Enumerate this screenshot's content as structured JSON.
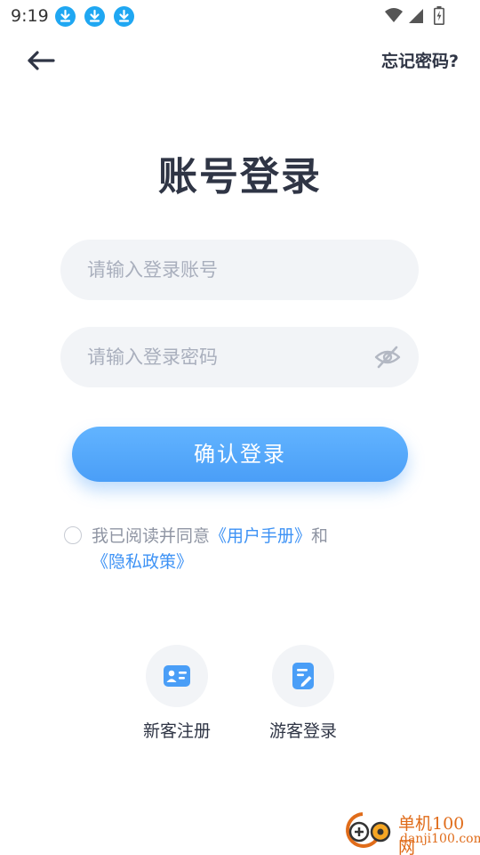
{
  "status_bar": {
    "time": "9:19",
    "notification_icons": [
      "download-icon",
      "download-icon",
      "download-icon"
    ],
    "system_icons": [
      "wifi-icon",
      "signal-icon",
      "battery-charging-icon"
    ]
  },
  "header": {
    "back_icon": "arrow-left-icon",
    "forgot_password": "忘记密码?"
  },
  "page_title": "账号登录",
  "form": {
    "account_placeholder": "请输入登录账号",
    "account_value": "",
    "password_placeholder": "请输入登录密码",
    "password_value": "",
    "password_visibility_icon": "eye-off-icon",
    "submit_label": "确认登录"
  },
  "agreement": {
    "checked": false,
    "prefix": "我已阅读并同意",
    "user_manual": "《用户手册》",
    "conjunction": "和",
    "privacy_policy": "《隐私政策》"
  },
  "actions": [
    {
      "label": "新客注册",
      "icon": "id-card-icon"
    },
    {
      "label": "游客登录",
      "icon": "edit-document-icon"
    }
  ],
  "watermark": {
    "title": "单机100网",
    "url": "danji100.com"
  },
  "colors": {
    "primary": "#4a9ef7",
    "link": "#3d92f5",
    "title": "#2f3545",
    "field_bg": "#f2f4f7",
    "placeholder": "#a9afbd"
  }
}
